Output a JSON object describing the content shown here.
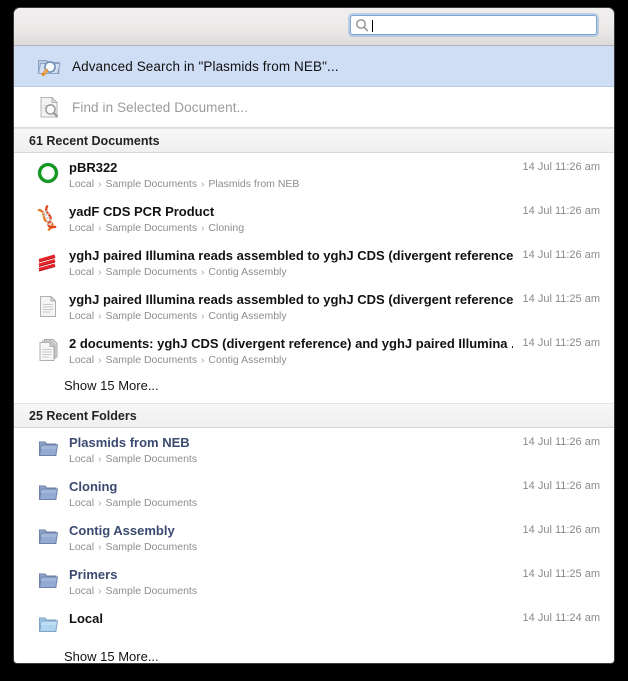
{
  "search": {
    "value": "",
    "placeholder": "",
    "icon": "search-icon"
  },
  "actions": [
    {
      "icon": "folder-search-icon",
      "label": "Advanced Search in \"Plasmids from NEB\"...",
      "selected": true,
      "enabled": true
    },
    {
      "icon": "document-search-icon",
      "label": "Find in Selected Document...",
      "selected": false,
      "enabled": false
    }
  ],
  "sections": [
    {
      "header": "61 Recent Documents",
      "more_label": "Show 15 More...",
      "items": [
        {
          "icon": "plasmid-circle-icon",
          "title": "pBR322",
          "title_style": "plain",
          "path": [
            "Local",
            "Sample Documents",
            "Plasmids from NEB"
          ],
          "time": "14 Jul 11:26 am"
        },
        {
          "icon": "dna-helix-icon",
          "title": "yadF CDS PCR Product",
          "title_style": "plain",
          "path": [
            "Local",
            "Sample Documents",
            "Cloning"
          ],
          "time": "14 Jul 11:26 am"
        },
        {
          "icon": "alignment-icon",
          "title": "yghJ paired Illumina reads assembled to yghJ CDS (divergent reference)",
          "title_style": "plain",
          "path": [
            "Local",
            "Sample Documents",
            "Contig Assembly"
          ],
          "time": "14 Jul 11:26 am"
        },
        {
          "icon": "document-icon",
          "title": "yghJ paired Illumina reads assembled to yghJ CDS (divergent reference...",
          "title_style": "plain",
          "path": [
            "Local",
            "Sample Documents",
            "Contig Assembly"
          ],
          "time": "14 Jul 11:25 am"
        },
        {
          "icon": "documents-stack-icon",
          "title": "2 documents: yghJ CDS (divergent reference) and yghJ paired Illumina ...",
          "title_style": "plain",
          "path": [
            "Local",
            "Sample Documents",
            "Contig Assembly"
          ],
          "time": "14 Jul 11:25 am"
        }
      ]
    },
    {
      "header": "25 Recent Folders",
      "more_label": "Show 15 More...",
      "items": [
        {
          "icon": "folder-icon",
          "title": "Plasmids from NEB",
          "title_style": "folder",
          "path": [
            "Local",
            "Sample Documents"
          ],
          "time": "14 Jul 11:26 am"
        },
        {
          "icon": "folder-icon",
          "title": "Cloning",
          "title_style": "folder",
          "path": [
            "Local",
            "Sample Documents"
          ],
          "time": "14 Jul 11:26 am"
        },
        {
          "icon": "folder-icon",
          "title": "Contig Assembly",
          "title_style": "folder",
          "path": [
            "Local",
            "Sample Documents"
          ],
          "time": "14 Jul 11:26 am"
        },
        {
          "icon": "folder-icon",
          "title": "Primers",
          "title_style": "folder",
          "path": [
            "Local",
            "Sample Documents"
          ],
          "time": "14 Jul 11:25 am"
        },
        {
          "icon": "folder-local-icon",
          "title": "Local",
          "title_style": "plain",
          "path": [],
          "time": "14 Jul 11:24 am"
        }
      ]
    }
  ],
  "colors": {
    "selection": "#cfddf5",
    "folder_text": "#3b4a70",
    "path_text": "#8e8e8e",
    "time_text": "#8a8a8a",
    "focus_ring": "#7da7d9"
  }
}
